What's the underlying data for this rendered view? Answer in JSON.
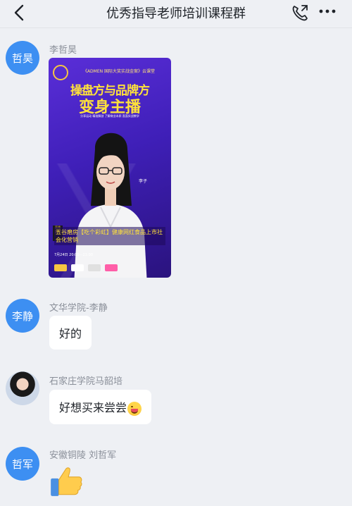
{
  "header": {
    "title": "优秀指导老师培训课程群"
  },
  "messages": [
    {
      "avatar_text": "哲昊",
      "sender": "李哲昊",
      "type": "image",
      "poster": {
        "top_line": "《ADMEN 国际大奖实战金案》云课堂",
        "headline_1": "操盘方与品牌方",
        "headline_2": "变身主播",
        "tags": "分享运动 精准解剖 了解商业本质 直面实战教学",
        "presenter": "李子",
        "case_title": "五谷磨房【吃个彩虹】健康网红食品上市社会化营销",
        "schedule": "7月24日 20:00—21:00"
      }
    },
    {
      "avatar_text": "李静",
      "sender": "文华学院-李静",
      "type": "text",
      "text": "好的"
    },
    {
      "avatar_text": "",
      "sender": "石家庄学院马韶培",
      "type": "text",
      "text": "好想买来尝尝"
    },
    {
      "avatar_text": "哲军",
      "sender": "安徽铜陵 刘哲军",
      "type": "emoji",
      "emoji": "thumbs-up"
    }
  ],
  "colors": {
    "background": "#eef0f4",
    "avatar_blue": "#3d8ff2",
    "bubble": "#ffffff",
    "poster_purple": "#4a24c8",
    "poster_yellow": "#ffe23a"
  },
  "icons": [
    "back-arrow-icon",
    "phone-call-icon",
    "more-dots-icon",
    "thumbs-up-emoji",
    "smile-emoji"
  ]
}
